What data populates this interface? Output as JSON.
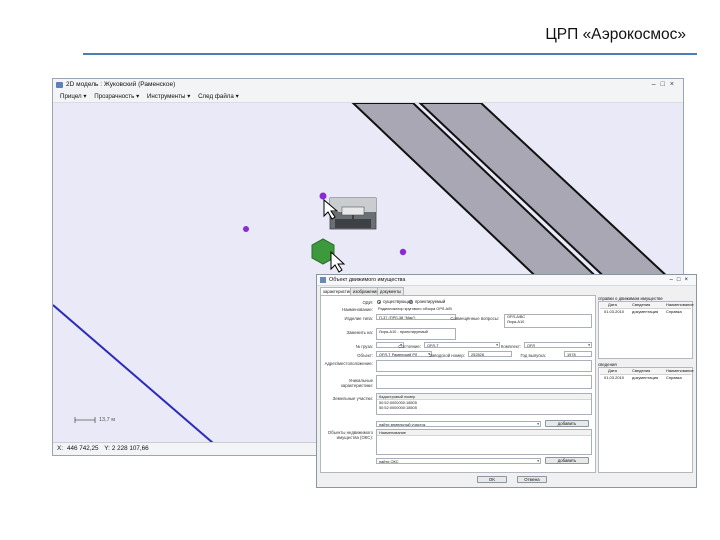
{
  "slide": {
    "title": "ЦРП «Аэрокосмос»"
  },
  "window": {
    "title": "2D модель : Жуковский (Раменское)",
    "controls": "–□×",
    "menu": [
      {
        "label": "Прицел"
      },
      {
        "label": "Прозрачность"
      },
      {
        "label": "Инструменты"
      },
      {
        "label": "След файла"
      }
    ],
    "menu_arrow": "▾",
    "status": {
      "x_label": "X:",
      "x_value": "446 742,25",
      "y_label": "Y:",
      "y_value": "2 228 107,66"
    },
    "scale_label": "13,7 м",
    "colors": {
      "canvas": "#e9e9f8",
      "runway_fill": "#a8a7b3",
      "marker": "#8a2bd6",
      "hexagon": "#3c9a3c",
      "line": "#2b2bb8"
    }
  },
  "dialog": {
    "title": "Объект движимого имущества",
    "controls": "–□×",
    "tabs": [
      "характеристики",
      "изображения",
      "документы"
    ],
    "fields": {
      "odi_label": "ОДИ:",
      "odi_option1": "существующий",
      "odi_option2": "проектируемый",
      "name_label": "Наименование:",
      "name_value": "Радиолокатор кругового обзора ОРЛ-А/В",
      "izd_label": "Изделие типа:",
      "izd_value": "П-37 (ПРЛ-38 \"Мак\")",
      "sovmest_label": "Совмещённые вопросы:",
      "sovmest_value1": "ОРЛ-А/ВС",
      "sovmest_value2": "Лира-А10",
      "zamenit_label": "Заменить на:",
      "zamenit_value": "Лира-А10 - проектируемый",
      "nom_label": "№ груза:",
      "sost_label": "Состояние:",
      "sost_value": "ОРЛ-Т",
      "komplekt_label": "Комплект:",
      "komplekt_value": "ОРЛ",
      "obekt_label": "Объект:",
      "obekt_value": "ОРЛ-Т Раменский РЛ",
      "zavod_label": "Заводской номер:",
      "zavod_value": "252828",
      "god_label": "Год выпуска:",
      "god_value": "1978",
      "adres_label": "Адрес/местоположение:",
      "unik_label": "Уникальные характеристики:",
      "zem_label": "Земельные участки:",
      "zem_head": "Кадастровый номер",
      "zem_rows": [
        "50:52:0000000:18505",
        "50:52:0000000:18505"
      ],
      "zem_select_placeholder": "найти земельный участок",
      "add_label": "добавить",
      "okc_label": "Объекты недвижимого имущества (ОКС):",
      "okc_head": "Наименование",
      "okc_select_placeholder": "найти ОКС",
      "ok_label": "OK",
      "cancel_label": "Отмена"
    },
    "side_top": {
      "title": "справки о движимом имуществе",
      "headers": [
        "Дата",
        "Сведения",
        "Наименование"
      ],
      "rows": [
        [
          "01.03.2010",
          "документация",
          "Справка"
        ]
      ]
    },
    "side_bottom": {
      "title": "сведения",
      "headers": [
        "Дата",
        "Сведения",
        "Наименование"
      ],
      "rows": [
        [
          "01.03.2010",
          "документация",
          "Справка"
        ]
      ]
    }
  }
}
